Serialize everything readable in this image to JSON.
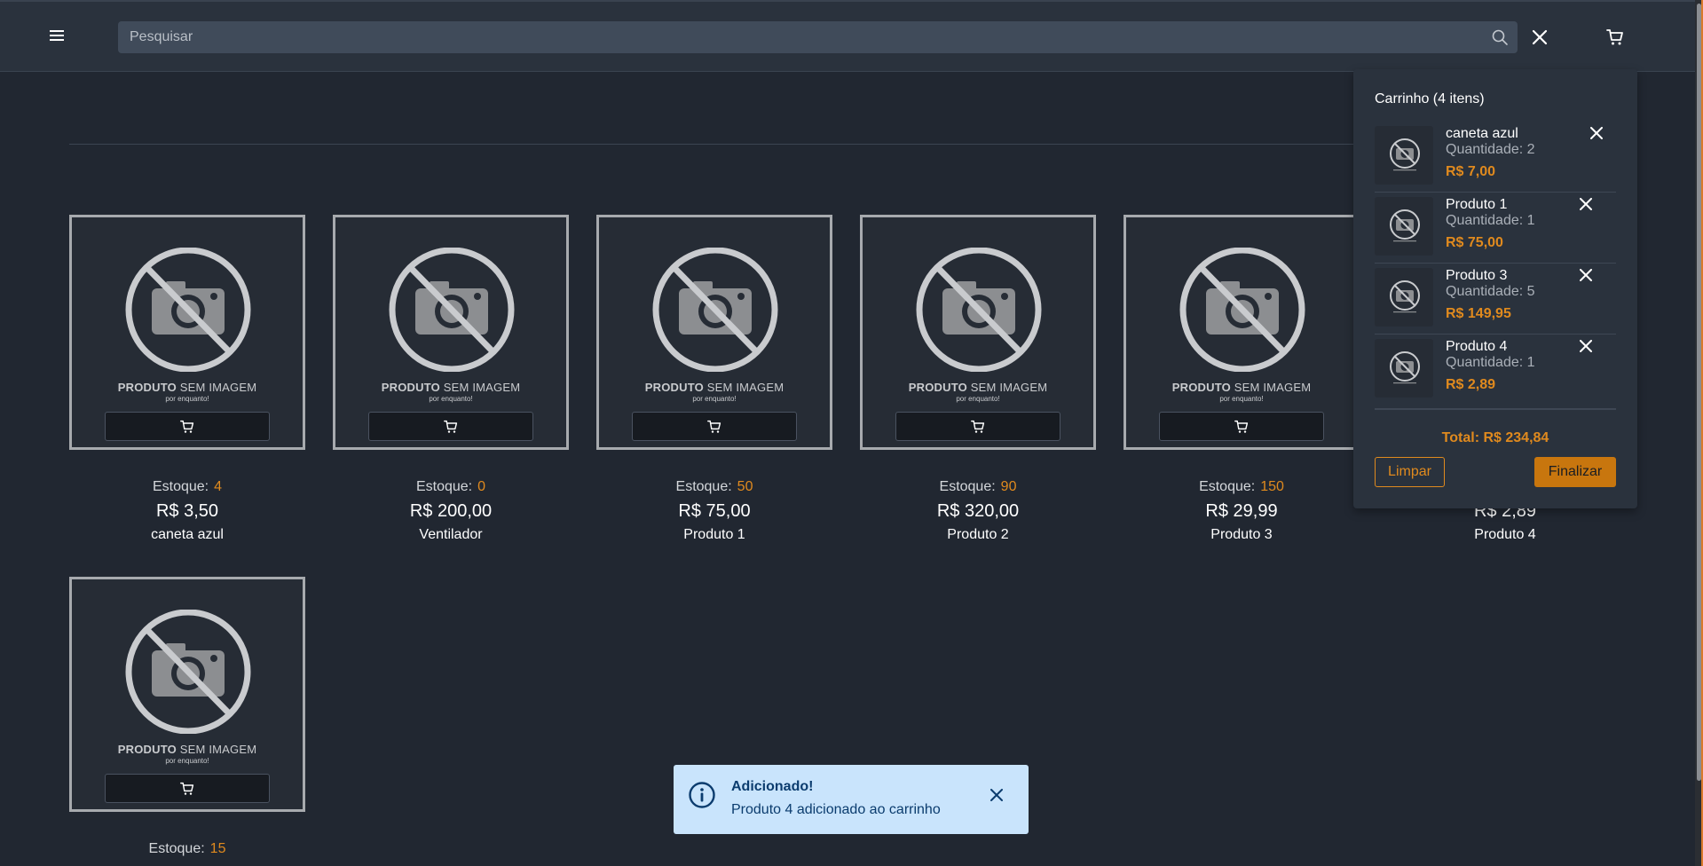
{
  "header": {
    "search_placeholder": "Pesquisar",
    "icons": {
      "menu": "hamburger-icon",
      "search": "search-icon",
      "close": "close-icon",
      "cart": "cart-icon"
    }
  },
  "colors": {
    "background": "#212731",
    "header": "#2a323d",
    "accent": "#e08a1e",
    "button_primary": "#c8760e",
    "toast_bg": "#c9e4fc",
    "toast_text": "#0b3c6e"
  },
  "products": {
    "stock_label": "Estoque:",
    "placeholder_caption_bold": "PRODUTO",
    "placeholder_caption_rest": " SEM IMAGEM",
    "placeholder_sub": "por enquanto!",
    "items": [
      {
        "name": "caneta azul",
        "price": "R$ 3,50",
        "stock": "4"
      },
      {
        "name": "Ventilador",
        "price": "R$ 200,00",
        "stock": "0"
      },
      {
        "name": "Produto 1",
        "price": "R$ 75,00",
        "stock": "50"
      },
      {
        "name": "Produto 2",
        "price": "R$ 320,00",
        "stock": "90"
      },
      {
        "name": "Produto 3",
        "price": "R$ 29,99",
        "stock": "150"
      },
      {
        "name": "Produto 4",
        "price": "R$ 2,89",
        "stock": ""
      },
      {
        "name": "",
        "price": "",
        "stock": "15"
      }
    ]
  },
  "cart": {
    "title": "Carrinho (4 itens)",
    "items": [
      {
        "name": "caneta azul",
        "quantity": "Quantidade: 2",
        "price": "R$ 7,00"
      },
      {
        "name": "Produto 1",
        "quantity": "Quantidade: 1",
        "price": "R$ 75,00"
      },
      {
        "name": "Produto 3",
        "quantity": "Quantidade: 5",
        "price": "R$ 149,95"
      },
      {
        "name": "Produto 4",
        "quantity": "Quantidade: 1",
        "price": "R$ 2,89"
      }
    ],
    "total": "Total: R$ 234,84",
    "clear_label": "Limpar",
    "finish_label": "Finalizar"
  },
  "toast": {
    "title": "Adicionado!",
    "message": "Produto 4 adicionado ao carrinho",
    "icon": "info-icon"
  }
}
